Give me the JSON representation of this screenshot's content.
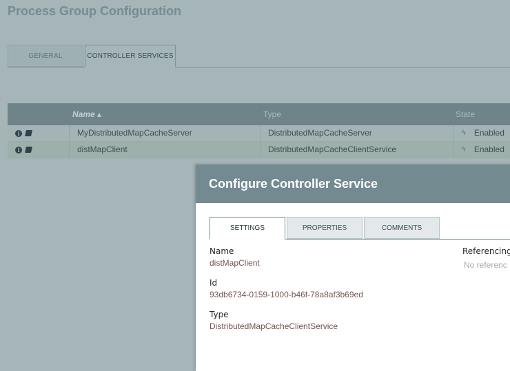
{
  "page": {
    "title": "Process Group Configuration",
    "tabs": [
      {
        "label": "GENERAL"
      },
      {
        "label": "CONTROLLER SERVICES"
      }
    ]
  },
  "grid": {
    "columns": {
      "name": "Name ▴",
      "type": "Type",
      "state": "State"
    },
    "rows": [
      {
        "name": "MyDistributedMapCacheServer",
        "type": "DistributedMapCacheServer",
        "state": "Enabled"
      },
      {
        "name": "distMapClient",
        "type": "DistributedMapCacheClientService",
        "state": "Enabled"
      }
    ]
  },
  "dialog": {
    "title": "Configure Controller Service",
    "tabs": [
      {
        "label": "SETTINGS"
      },
      {
        "label": "PROPERTIES"
      },
      {
        "label": "COMMENTS"
      }
    ],
    "fields": {
      "name_label": "Name",
      "name_value": "distMapClient",
      "id_label": "Id",
      "id_value": "93db6734-0159-1000-b46f-78a8af3b69ed",
      "type_label": "Type",
      "type_value": "DistributedMapCacheClientService",
      "referencing_label": "Referencing",
      "referencing_value": "No referenc"
    }
  },
  "icons": {
    "info": "i",
    "bolt": "ϟ"
  },
  "colors": {
    "header": "#728a90",
    "value_text": "#775351",
    "enabled_bolt": "#4a7f9b"
  }
}
